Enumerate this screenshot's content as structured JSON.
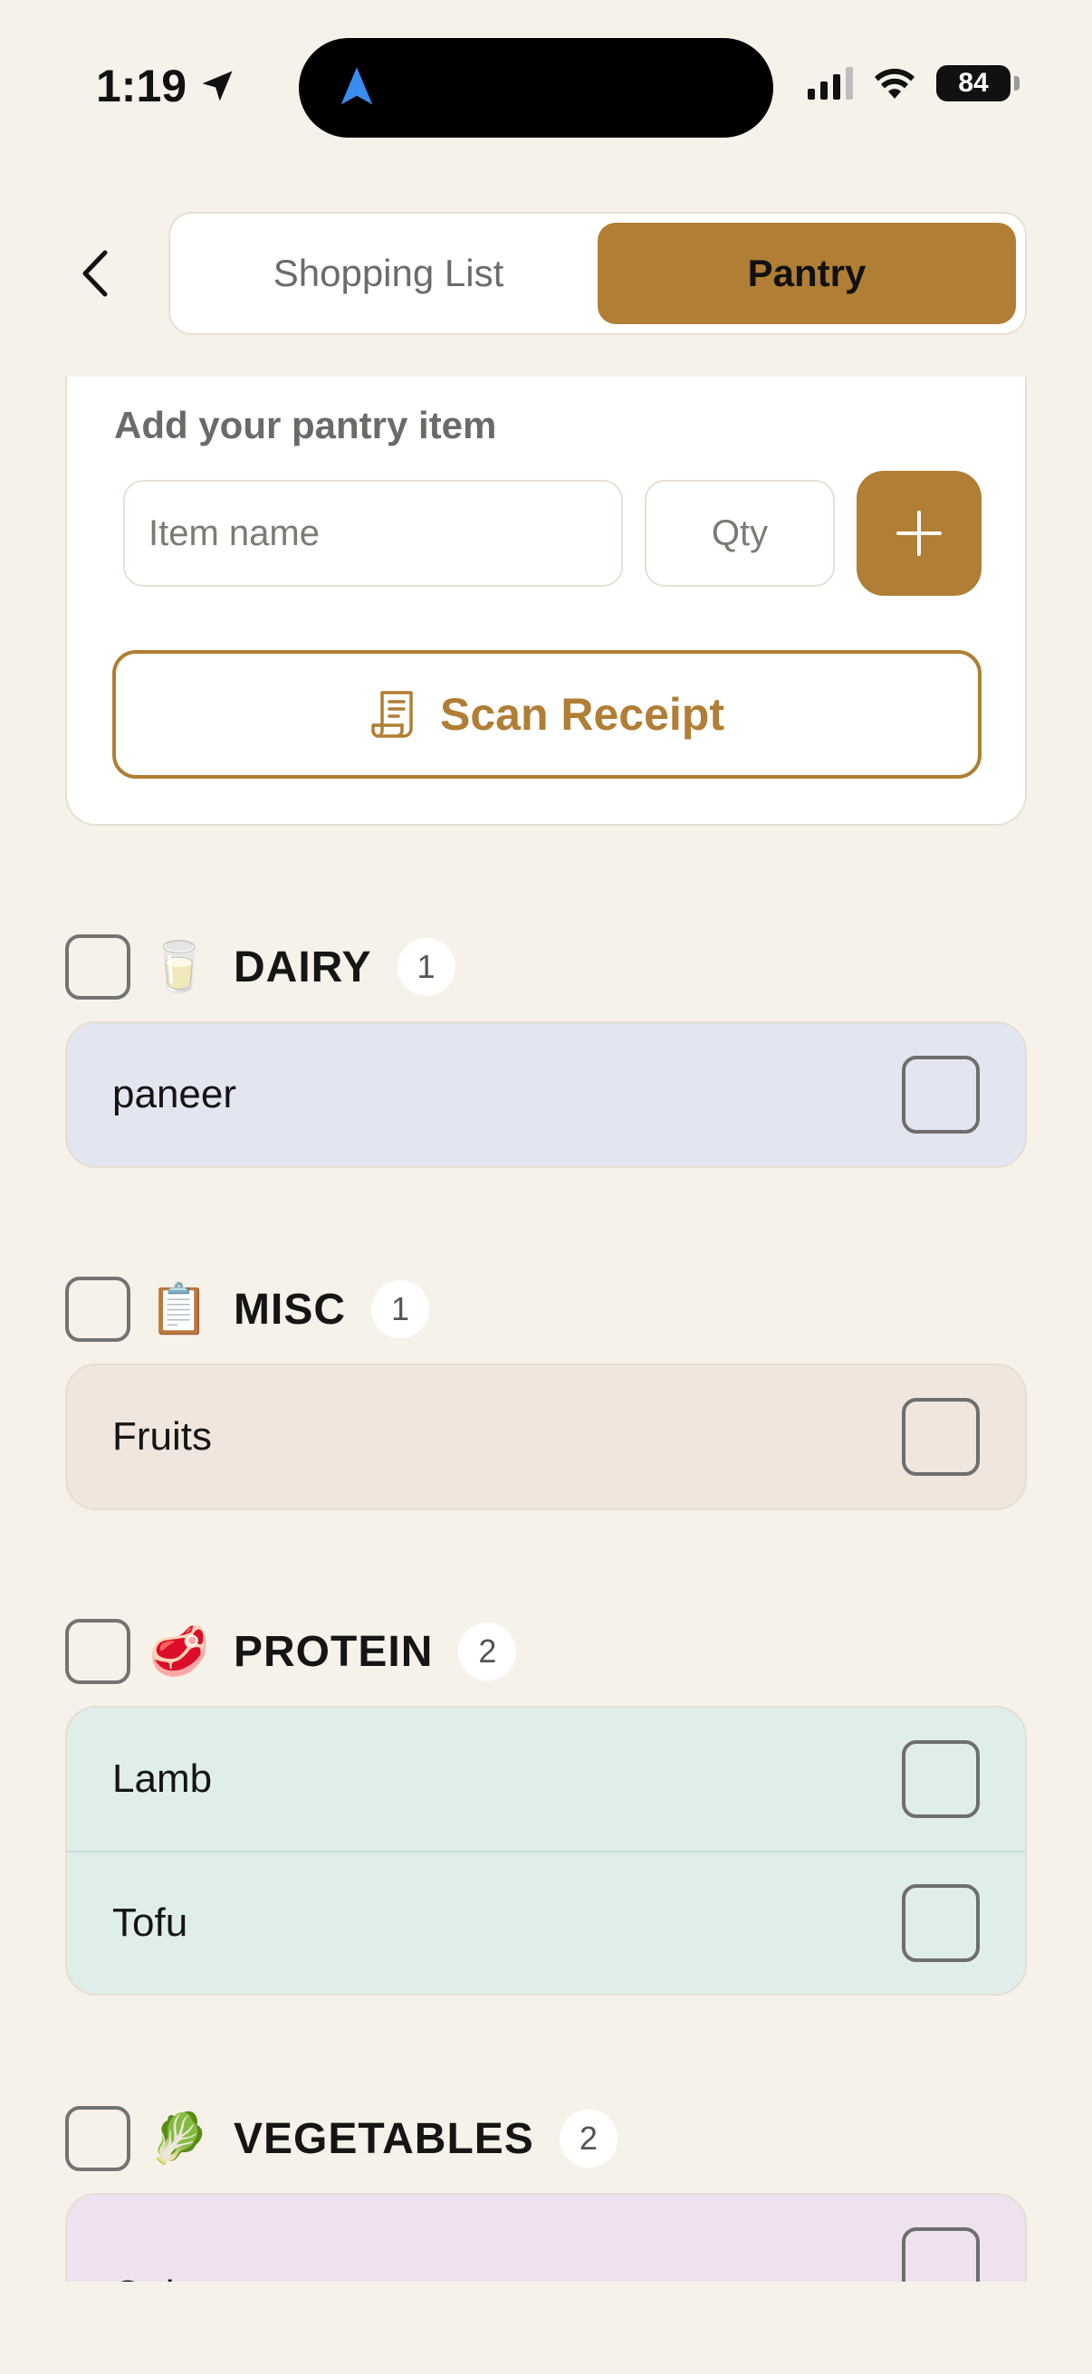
{
  "status_bar": {
    "time": "1:19",
    "battery": "84"
  },
  "header": {
    "tabs": [
      {
        "label": "Shopping List",
        "active": false
      },
      {
        "label": "Pantry",
        "active": true
      }
    ]
  },
  "add_form": {
    "title": "Add your pantry item",
    "item_placeholder": "Item name",
    "qty_placeholder": "Qty",
    "scan_label": "Scan Receipt"
  },
  "colors": {
    "accent": "#B07E34",
    "background": "#F6F2EA",
    "dairy": "#E3E6F0",
    "misc": "#F0E6DD",
    "protein": "#DFEEEB",
    "vegetables": "#EFE2EE"
  },
  "categories": [
    {
      "name": "DAIRY",
      "emoji": "🥛",
      "icon": "milk-glass-icon",
      "count": "1",
      "items": [
        "paneer"
      ]
    },
    {
      "name": "MISC",
      "emoji": "📋",
      "icon": "clipboard-icon",
      "count": "1",
      "items": [
        "Fruits"
      ]
    },
    {
      "name": "PROTEIN",
      "emoji": "🥩",
      "icon": "meat-icon",
      "count": "2",
      "items": [
        "Lamb",
        "Tofu"
      ]
    },
    {
      "name": "VEGETABLES",
      "emoji": "🥬",
      "icon": "leafy-greens-icon",
      "count": "2",
      "items": [
        "Onions"
      ]
    }
  ]
}
